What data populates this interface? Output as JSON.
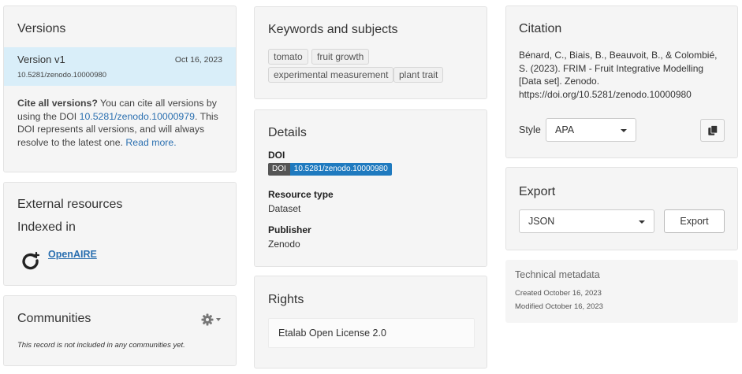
{
  "versions": {
    "title": "Versions",
    "current": {
      "label": "Version v1",
      "date": "Oct 16, 2023",
      "doi": "10.5281/zenodo.10000980"
    },
    "cite_bold": "Cite all versions?",
    "cite_pre": " You can cite all versions by using the DOI ",
    "cite_doi": "10.5281/zenodo.10000979",
    "cite_post": ". This DOI represents all versions, and will always resolve to the latest one. ",
    "read_more": "Read more."
  },
  "external": {
    "title": "External resources",
    "indexed_in": "Indexed in",
    "openaire": "OpenAIRE"
  },
  "communities": {
    "title": "Communities",
    "note": "This record is not included in any communities yet.",
    "icon": "gear-icon"
  },
  "keywords": {
    "title": "Keywords and subjects",
    "tags": [
      "tomato",
      "fruit growth",
      "experimental measurement",
      "plant trait"
    ]
  },
  "details": {
    "title": "Details",
    "doi_label": "DOI",
    "doi_badge_key": "DOI",
    "doi_value": "10.5281/zenodo.10000980",
    "resource_type_label": "Resource type",
    "resource_type": "Dataset",
    "publisher_label": "Publisher",
    "publisher": "Zenodo"
  },
  "rights": {
    "title": "Rights",
    "license": "Etalab Open License 2.0"
  },
  "citation": {
    "title": "Citation",
    "text": "Bénard, C., Biais, B., Beauvoit, B., & Colombié, S. (2023). FRIM - Fruit Integrative Modelling [Data set]. Zenodo. https://doi.org/10.5281/zenodo.10000980",
    "style_label": "Style",
    "style_value": "APA",
    "copy_icon": "copy-icon"
  },
  "export": {
    "title": "Export",
    "format": "JSON",
    "button": "Export"
  },
  "technical": {
    "title": "Technical metadata",
    "created": "Created October 16, 2023",
    "modified": "Modified October 16, 2023"
  },
  "colors": {
    "link": "#2a6fb0",
    "selected_row": "#d9eef9",
    "panel_bg": "#f5f5f5",
    "doi_badge": "#1f7abf"
  }
}
